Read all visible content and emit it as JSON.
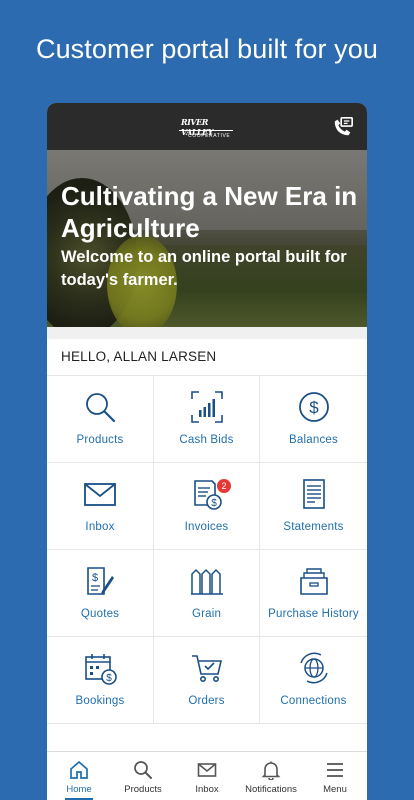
{
  "headline": "Customer portal built for you",
  "logo": {
    "line1": "RIVER VALLEY",
    "line2": "COOPERATIVE"
  },
  "hero": {
    "title": "Cultivating a New Era in Agriculture",
    "subtitle": "Welcome to an online portal built for today's farmer."
  },
  "greeting": "HELLO, ALLAN LARSEN",
  "tiles": [
    {
      "label": "Products",
      "icon": "search-icon"
    },
    {
      "label": "Cash Bids",
      "icon": "chart-icon"
    },
    {
      "label": "Balances",
      "icon": "dollar-icon"
    },
    {
      "label": "Inbox",
      "icon": "envelope-icon"
    },
    {
      "label": "Invoices",
      "icon": "invoice-icon",
      "badge": "2"
    },
    {
      "label": "Statements",
      "icon": "statement-icon"
    },
    {
      "label": "Quotes",
      "icon": "quote-icon"
    },
    {
      "label": "Grain",
      "icon": "grain-bins-icon"
    },
    {
      "label": "Purchase History",
      "icon": "file-drawer-icon"
    },
    {
      "label": "Bookings",
      "icon": "calendar-dollar-icon"
    },
    {
      "label": "Orders",
      "icon": "cart-icon"
    },
    {
      "label": "Connections",
      "icon": "globe-icon"
    }
  ],
  "nav": [
    {
      "label": "Home",
      "icon": "home-icon",
      "active": true
    },
    {
      "label": "Products",
      "icon": "search-icon"
    },
    {
      "label": "Inbox",
      "icon": "envelope-icon"
    },
    {
      "label": "Notifications",
      "icon": "bell-icon"
    },
    {
      "label": "Menu",
      "icon": "menu-icon"
    }
  ],
  "colors": {
    "background": "#2d6bb0",
    "accent": "#1f6fae",
    "appbar": "#2b2b2b",
    "badge": "#e53935"
  }
}
